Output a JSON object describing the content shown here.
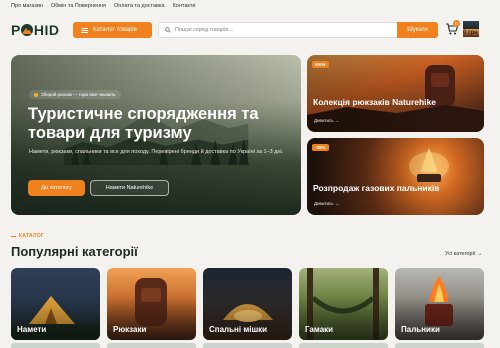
{
  "topbar": {
    "links": [
      "Про магазин",
      "Обмін та Повернення",
      "Оплата та доставка",
      "Контакти"
    ]
  },
  "header": {
    "logo_text_left": "P",
    "logo_text_right": "HID",
    "catalog_label": "Каталог товарів",
    "search_placeholder": "Пошук серед товарів...",
    "search_button": "Шукати",
    "cart_label": "Кошик",
    "cart_total": "0 грн",
    "cart_count": "0"
  },
  "hero": {
    "tag": "Збирай рюкзак — гори вже чекають",
    "title": "Туристичне спорядження та товари для туризму",
    "description": "Намети, рюкзаки, спальники та все для походу. Перевірені бренди й доставка по Україні за 1–3 дні.",
    "primary_button": "До каталогу",
    "secondary_button": "Намети Naturehike"
  },
  "promos": [
    {
      "chip": "NEW",
      "title": "Колекція рюкзаків Naturehike",
      "link": "Дивитись →"
    },
    {
      "chip": "-30%",
      "title": "Розпродаж газових пальників",
      "link": "Дивитись →"
    }
  ],
  "catalog": {
    "tag": "КАТАЛОГ",
    "title": "Популярні категорії",
    "all_link": "Усі категорії →",
    "tiles": [
      "Намети",
      "Рюкзаки",
      "Спальні мішки",
      "Гамаки",
      "Пальники"
    ]
  },
  "colors": {
    "accent": "#f0811f",
    "brand": "#1d3b2e",
    "background": "#f4f2ee"
  }
}
